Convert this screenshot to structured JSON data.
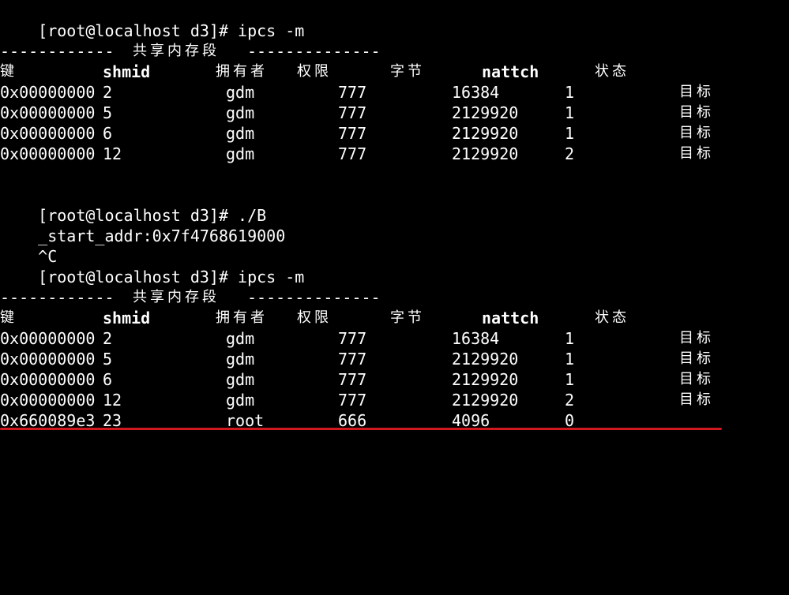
{
  "colors": {
    "background": "#000000",
    "text": "#ffffff",
    "annotation_line": "#d0191f"
  },
  "blocks": [
    {
      "prompt": "[root@localhost d3]# ipcs -m",
      "separator": {
        "left": "------------",
        "title": "共享内存段",
        "right": "--------------"
      },
      "header": {
        "key": "键",
        "shmid": "shmid",
        "owner": "拥有者",
        "perms": "权限",
        "bytes": "字节",
        "nattch": "nattch",
        "status": "状态"
      },
      "rows": [
        {
          "key": "0x00000000",
          "shmid": "2",
          "owner": "gdm",
          "perms": "777",
          "bytes": "16384",
          "nattch": "1",
          "status": "目标"
        },
        {
          "key": "0x00000000",
          "shmid": "5",
          "owner": "gdm",
          "perms": "777",
          "bytes": "2129920",
          "nattch": "1",
          "status": "目标"
        },
        {
          "key": "0x00000000",
          "shmid": "6",
          "owner": "gdm",
          "perms": "777",
          "bytes": "2129920",
          "nattch": "1",
          "status": "目标"
        },
        {
          "key": "0x00000000",
          "shmid": "12",
          "owner": "gdm",
          "perms": "777",
          "bytes": "2129920",
          "nattch": "2",
          "status": "目标"
        }
      ]
    },
    {
      "prompt": "[root@localhost d3]# ipcs -m",
      "separator": {
        "left": "------------",
        "title": "共享内存段",
        "right": "--------------"
      },
      "header": {
        "key": "键",
        "shmid": "shmid",
        "owner": "拥有者",
        "perms": "权限",
        "bytes": "字节",
        "nattch": "nattch",
        "status": "状态"
      },
      "rows": [
        {
          "key": "0x00000000",
          "shmid": "2",
          "owner": "gdm",
          "perms": "777",
          "bytes": "16384",
          "nattch": "1",
          "status": "目标"
        },
        {
          "key": "0x00000000",
          "shmid": "5",
          "owner": "gdm",
          "perms": "777",
          "bytes": "2129920",
          "nattch": "1",
          "status": "目标"
        },
        {
          "key": "0x00000000",
          "shmid": "6",
          "owner": "gdm",
          "perms": "777",
          "bytes": "2129920",
          "nattch": "1",
          "status": "目标"
        },
        {
          "key": "0x00000000",
          "shmid": "12",
          "owner": "gdm",
          "perms": "777",
          "bytes": "2129920",
          "nattch": "2",
          "status": "目标"
        },
        {
          "key": "0x660089e3",
          "shmid": "23",
          "owner": "root",
          "perms": "666",
          "bytes": "4096",
          "nattch": "0",
          "status": ""
        }
      ]
    }
  ],
  "run": {
    "prompt": "[root@localhost d3]# ./B",
    "output": "_start_addr:0x7f4768619000",
    "interrupt": "^C"
  }
}
